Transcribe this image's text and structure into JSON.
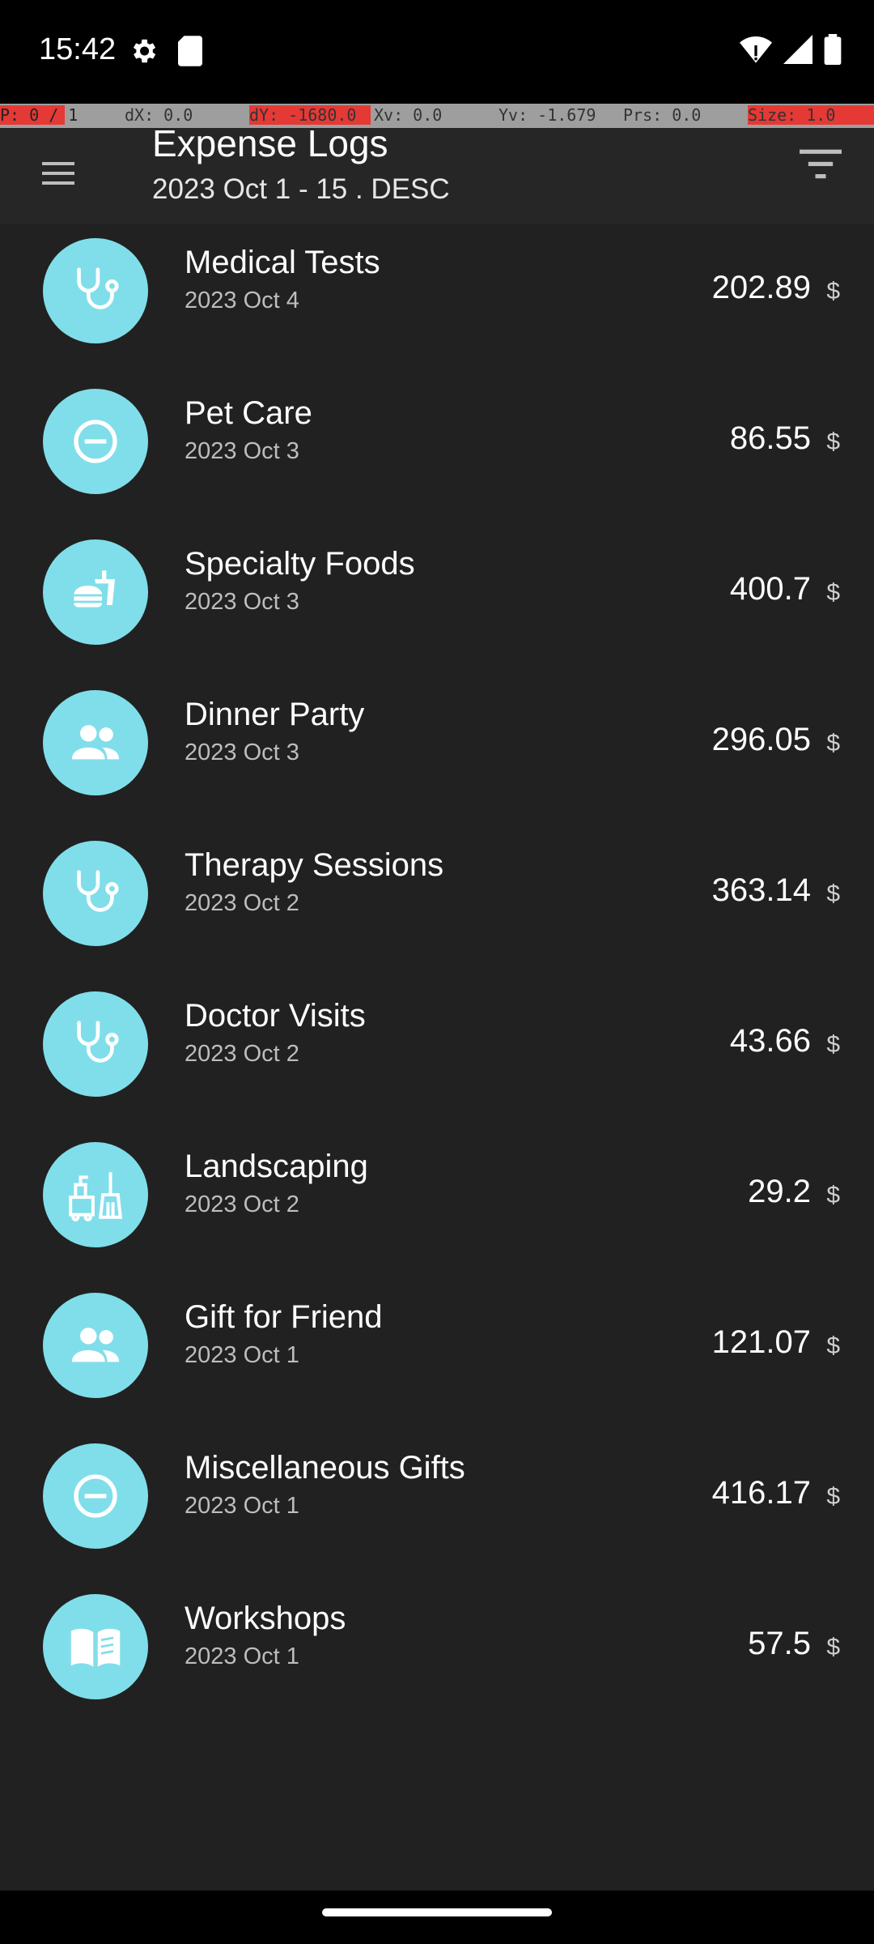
{
  "status_bar": {
    "time": "15:42"
  },
  "debug": {
    "p": "P: 0 / 1",
    "dx": "dX: 0.0",
    "dy": "dY: -1680.0",
    "xv": "Xv: 0.0",
    "yv": "Yv: -1.679",
    "prs": "Prs: 0.0",
    "size": "Size: 1.0"
  },
  "header": {
    "title": "Expense Logs",
    "subtitle": "2023 Oct 1 - 15 . DESC"
  },
  "currency_symbol": "$",
  "accent_color": "#80deea",
  "items": [
    {
      "name": "Medical Tests",
      "date": "2023 Oct 4",
      "amount": "202.89",
      "icon": "stethoscope-icon"
    },
    {
      "name": "Pet Care",
      "date": "2023 Oct 3",
      "amount": "86.55",
      "icon": "minus-circle-icon"
    },
    {
      "name": "Specialty Foods",
      "date": "2023 Oct 3",
      "amount": "400.7",
      "icon": "fastfood-icon"
    },
    {
      "name": "Dinner Party",
      "date": "2023 Oct 3",
      "amount": "296.05",
      "icon": "people-icon"
    },
    {
      "name": "Therapy Sessions",
      "date": "2023 Oct 2",
      "amount": "363.14",
      "icon": "stethoscope-icon"
    },
    {
      "name": "Doctor Visits",
      "date": "2023 Oct 2",
      "amount": "43.66",
      "icon": "stethoscope-icon"
    },
    {
      "name": "Landscaping",
      "date": "2023 Oct 2",
      "amount": "29.2",
      "icon": "cleaning-icon"
    },
    {
      "name": "Gift for Friend",
      "date": "2023 Oct 1",
      "amount": "121.07",
      "icon": "people-icon"
    },
    {
      "name": "Miscellaneous Gifts",
      "date": "2023 Oct 1",
      "amount": "416.17",
      "icon": "minus-circle-icon"
    },
    {
      "name": "Workshops",
      "date": "2023 Oct 1",
      "amount": "57.5",
      "icon": "book-icon"
    }
  ]
}
